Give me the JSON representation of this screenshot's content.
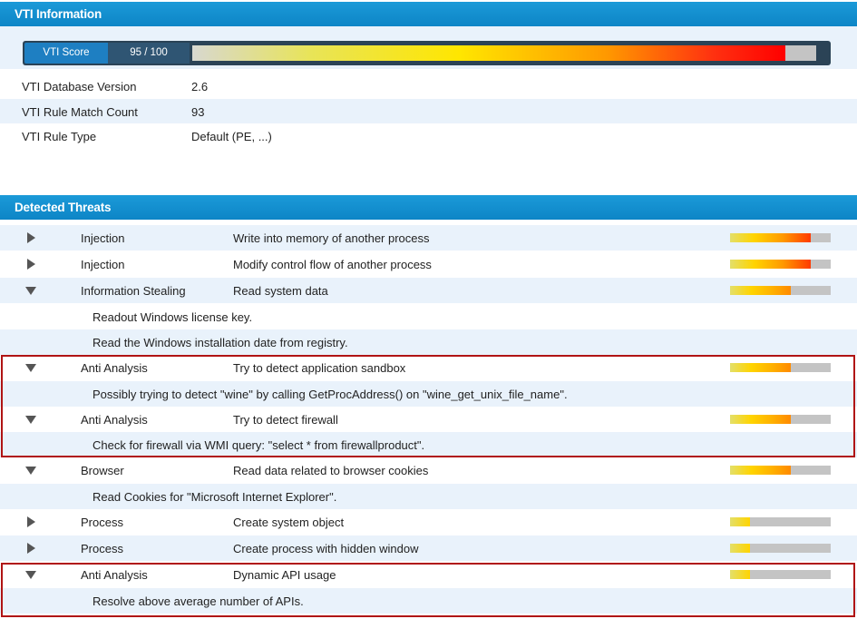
{
  "vti": {
    "title": "VTI Information",
    "score_label": "VTI Score",
    "score_value": "95 / 100",
    "score_fraction": 0.95,
    "db_version_label": "VTI Database Version",
    "db_version": "2.6",
    "rule_count_label": "VTI Rule Match Count",
    "rule_count": "93",
    "rule_type_label": "VTI Rule Type",
    "rule_type": "Default (PE, ...)"
  },
  "threats": {
    "title": "Detected Threats",
    "rows": [
      {
        "expanded": false,
        "category": "Injection",
        "description": "Write into memory of another process",
        "severity": 0.8
      },
      {
        "expanded": false,
        "category": "Injection",
        "description": "Modify control flow of another process",
        "severity": 0.8
      },
      {
        "expanded": true,
        "category": "Information Stealing",
        "description": "Read system data",
        "severity": 0.6
      },
      {
        "expanded": true,
        "category": "Anti Analysis",
        "description": "Try to detect application sandbox",
        "severity": 0.6
      },
      {
        "expanded": true,
        "category": "Anti Analysis",
        "description": "Try to detect firewall",
        "severity": 0.6
      },
      {
        "expanded": true,
        "category": "Browser",
        "description": "Read data related to browser cookies",
        "severity": 0.6
      },
      {
        "expanded": false,
        "category": "Process",
        "description": "Create system object",
        "severity": 0.2
      },
      {
        "expanded": false,
        "category": "Process",
        "description": "Create process with hidden window",
        "severity": 0.2
      },
      {
        "expanded": true,
        "category": "Anti Analysis",
        "description": "Dynamic API usage",
        "severity": 0.2
      }
    ],
    "details": [
      "Readout Windows license key.",
      "Read the Windows installation date from registry.",
      "Possibly trying to detect \"wine\" by calling GetProcAddress() on \"wine_get_unix_file_name\".",
      "Check for firewall via WMI query: \"select * from firewallproduct\".",
      "Read Cookies for \"Microsoft Internet Explorer\".",
      "Resolve above average number of APIs."
    ]
  },
  "colors": {
    "header": "#1790d0",
    "row_alt": "#e9f2fb",
    "highlight": "#b01414",
    "arrow": "#555555"
  }
}
